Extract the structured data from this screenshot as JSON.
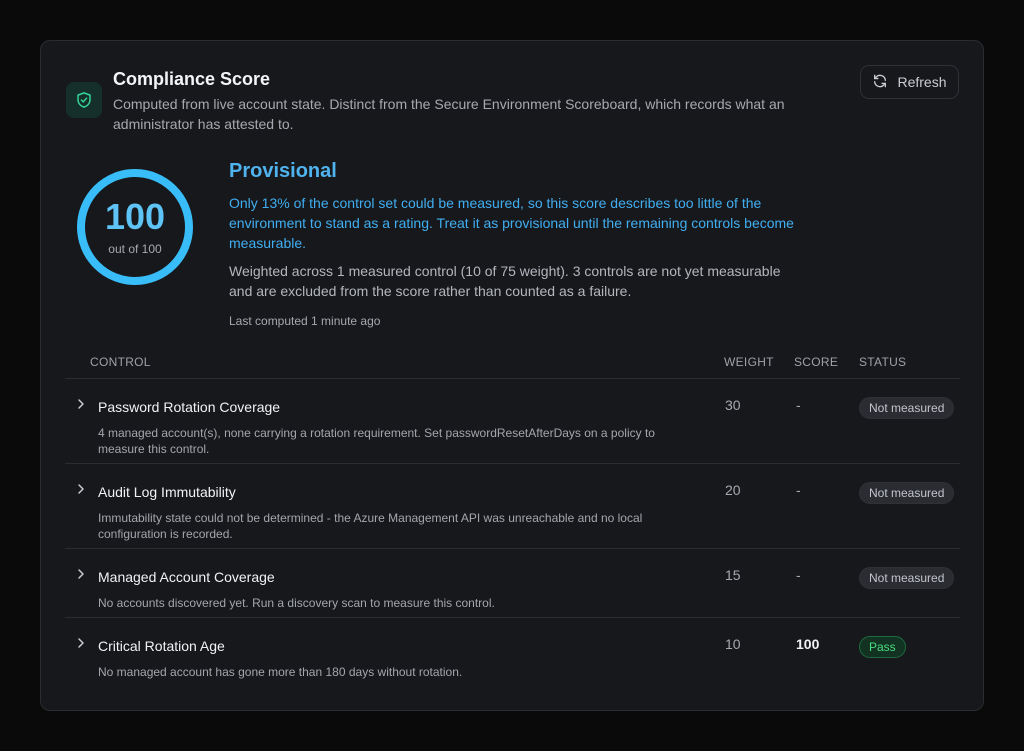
{
  "header": {
    "title": "Compliance Score",
    "subtitle": "Computed from live account state. Distinct from the Secure Environment Scoreboard, which records what an administrator has attested to.",
    "icon": "shield-check-icon",
    "accent_color": "#34d399"
  },
  "refresh_button": {
    "label": "Refresh",
    "icon": "refresh-icon"
  },
  "score": {
    "value": "100",
    "caption": "out of 100",
    "fraction": 1.0,
    "color": "#38bdf8"
  },
  "provisional": {
    "title": "Provisional",
    "warning": "Only 13% of the control set could be measured, so this score describes too little of the environment to stand as a rating. Treat it as provisional until the remaining controls become measurable.",
    "description": "Weighted across 1 measured control (10 of 75 weight). 3 controls are not yet measurable and are excluded from the score rather than counted as a failure.",
    "last_computed": "Last computed 1 minute ago"
  },
  "table": {
    "headers": {
      "control": "CONTROL",
      "weight": "WEIGHT",
      "score": "SCORE",
      "status": "STATUS"
    },
    "rows": [
      {
        "name": "Password Rotation Coverage",
        "description": "4 managed account(s), none carrying a rotation requirement. Set passwordResetAfterDays on a policy to measure this control.",
        "weight": "30",
        "score": "-",
        "status": "Not measured"
      },
      {
        "name": "Audit Log Immutability",
        "description": "Immutability state could not be determined - the Azure Management API was unreachable and no local configuration is recorded.",
        "weight": "20",
        "score": "-",
        "status": "Not measured"
      },
      {
        "name": "Managed Account Coverage",
        "description": "No accounts discovered yet. Run a discovery scan to measure this control.",
        "weight": "15",
        "score": "-",
        "status": "Not measured"
      },
      {
        "name": "Critical Rotation Age",
        "description": "No managed account has gone more than 180 days without rotation.",
        "weight": "10",
        "score": "100",
        "status": "Pass"
      }
    ]
  }
}
